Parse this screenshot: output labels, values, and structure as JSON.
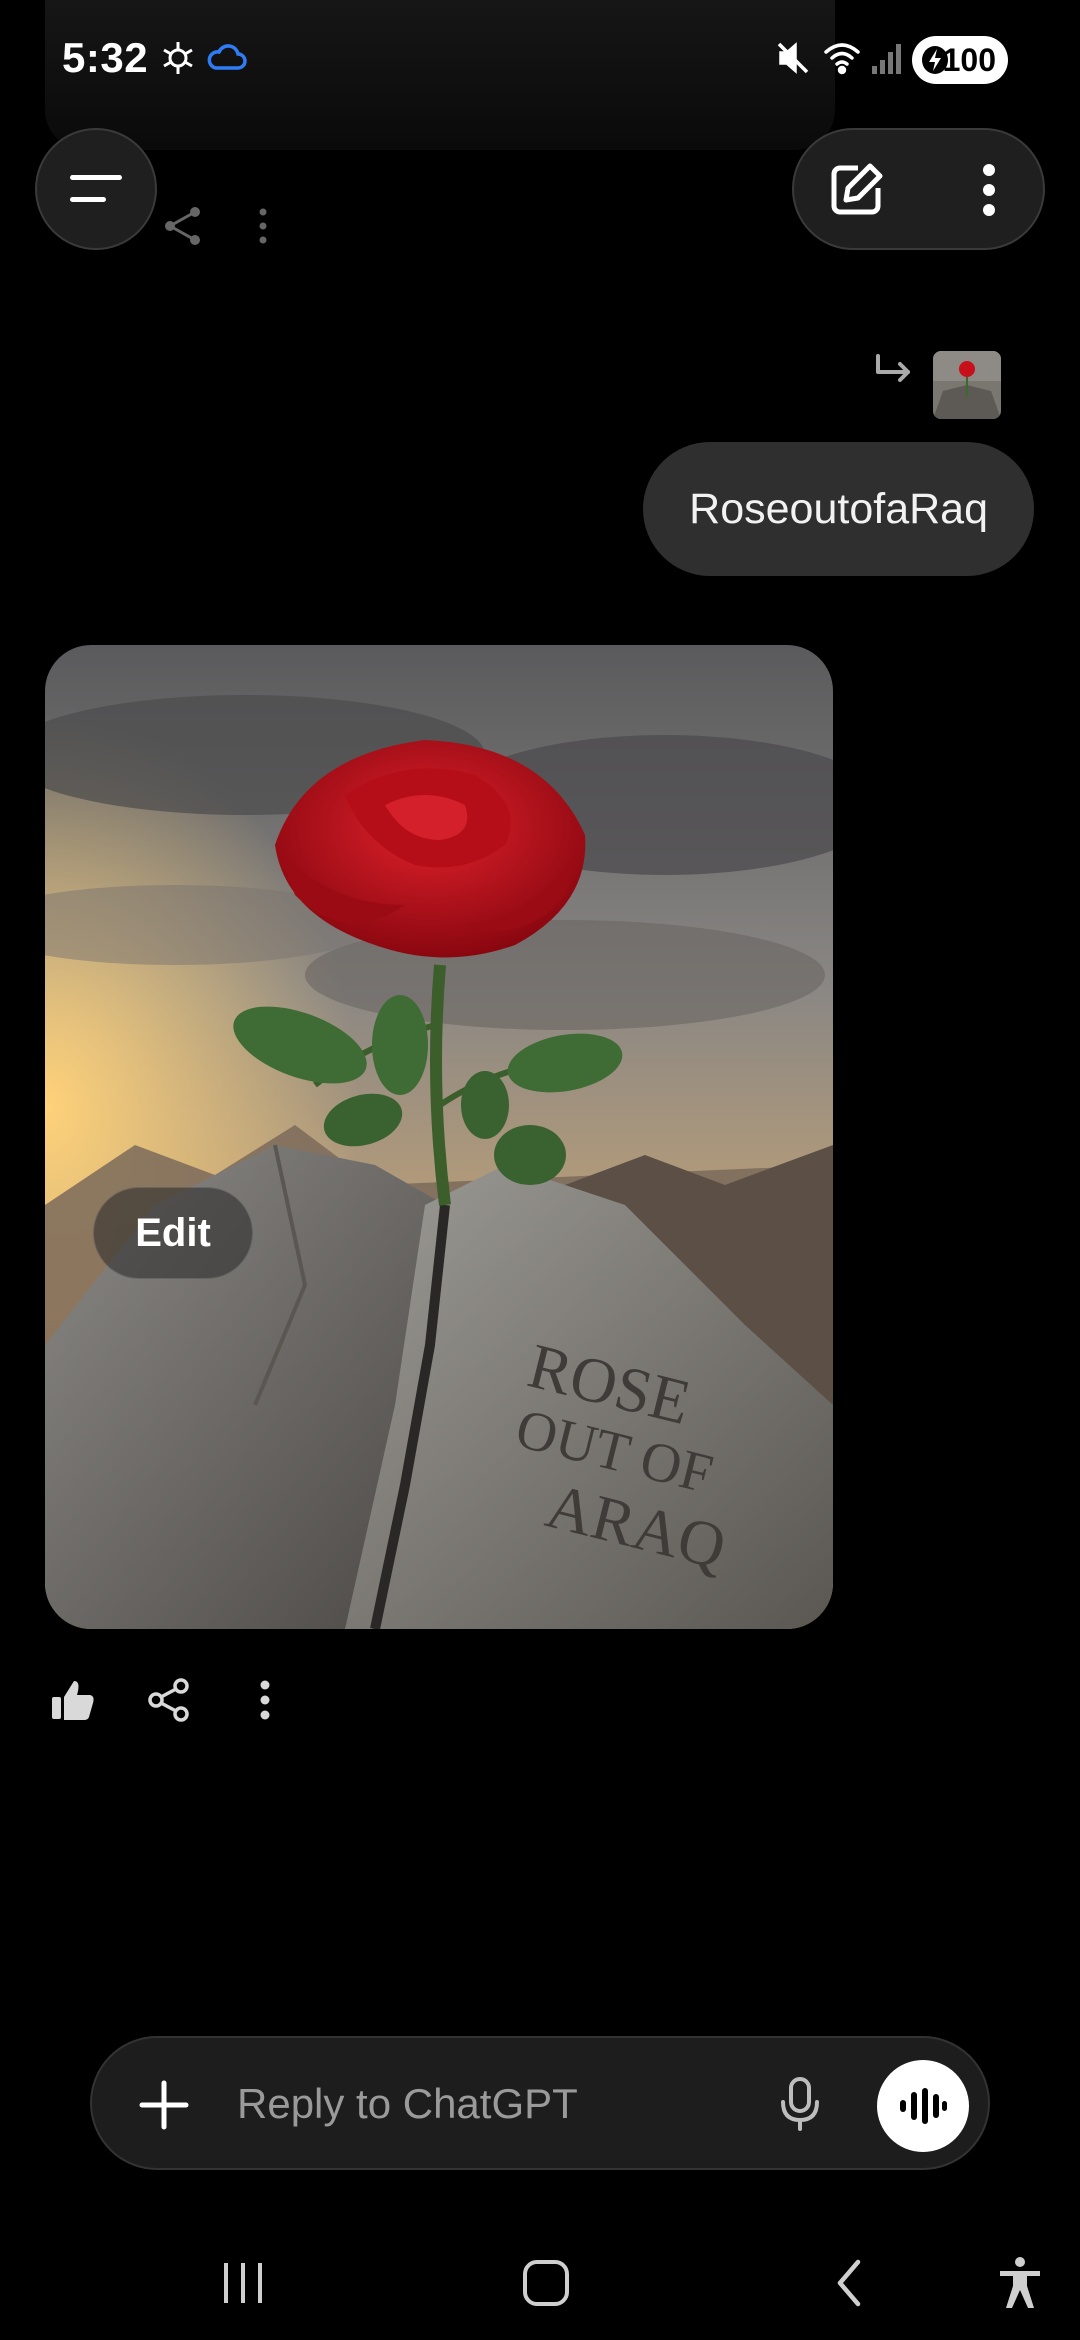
{
  "status_bar": {
    "time": "5:32",
    "battery": "100"
  },
  "header": {
    "menu_icon": "hamburger-icon",
    "new_chat_icon": "edit-icon",
    "more_icon": "more-vertical-icon"
  },
  "conversation": {
    "user_message": "RoseoutofaRaq",
    "attachment_icon": "reply-arrow-icon",
    "image_edit_label": "Edit",
    "image_engraving": [
      "ROSE",
      "OUT OF",
      "ARAQ"
    ]
  },
  "feedback": {
    "icons": [
      "thumbs-up-icon",
      "share-icon",
      "more-vertical-icon"
    ]
  },
  "composer": {
    "placeholder": "Reply to ChatGPT"
  },
  "colors": {
    "background": "#000000",
    "bubble": "#2f2f2f",
    "rose_red": "#c8101a",
    "accent_cloud": "#2f7df6"
  }
}
